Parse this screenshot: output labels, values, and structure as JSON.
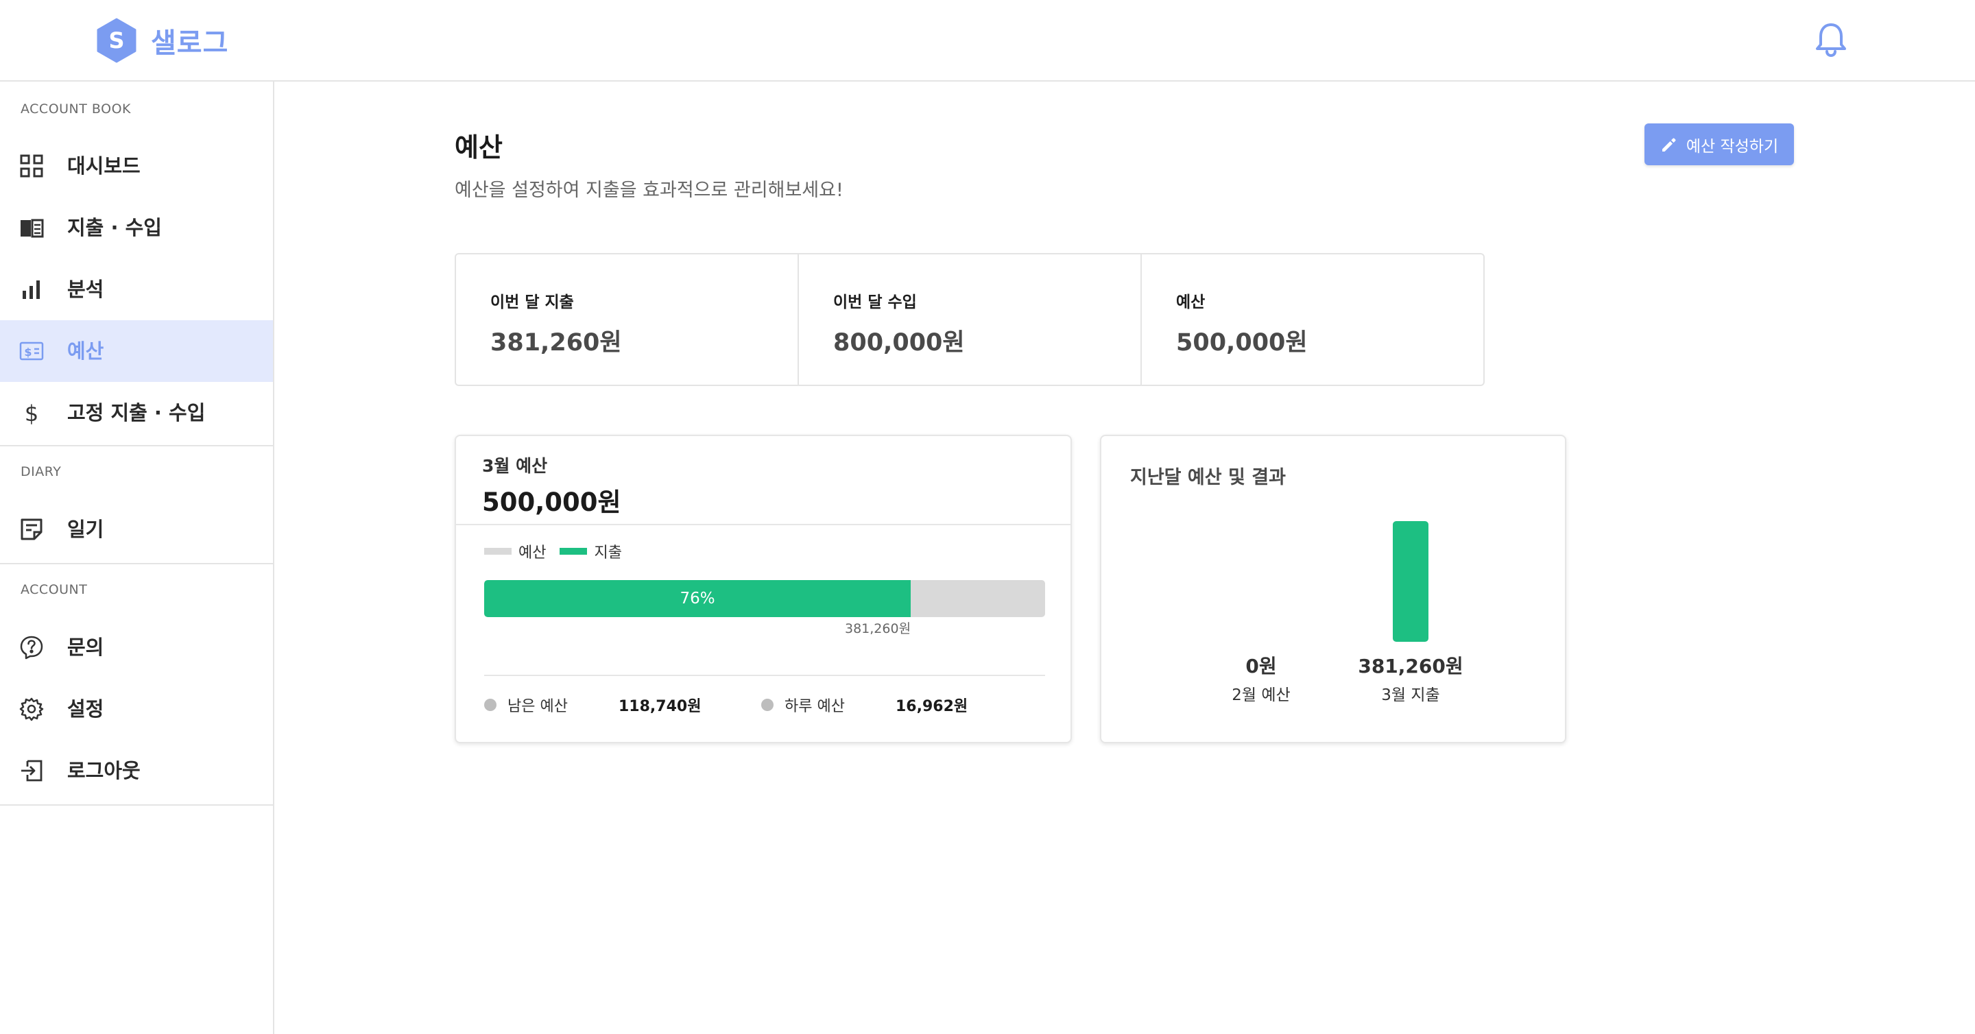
{
  "header": {
    "brand": "샐로그",
    "brand_color": "#7b9cf1",
    "logo_letter": "S",
    "icons": {
      "logo": "logo-hexagon-icon",
      "notification": "bell-icon"
    }
  },
  "sidebar": {
    "sections": [
      {
        "title": "ACCOUNT BOOK"
      },
      {
        "title": "DIARY"
      },
      {
        "title": "ACCOUNT"
      }
    ],
    "items": [
      {
        "label": "대시보드",
        "icon": "dashboard-grid-icon"
      },
      {
        "label": "지출 · 수입",
        "icon": "book-icon"
      },
      {
        "label": "분석",
        "icon": "bar-chart-icon"
      },
      {
        "label": "예산",
        "icon": "budget-card-icon",
        "active": true
      },
      {
        "label": "고정 지출 · 수입",
        "icon": "dollar-icon"
      },
      {
        "label": "일기",
        "icon": "note-icon"
      },
      {
        "label": "문의",
        "icon": "question-icon"
      },
      {
        "label": "설정",
        "icon": "gear-icon"
      },
      {
        "label": "로그아웃",
        "icon": "logout-icon"
      }
    ],
    "active_color": "#e3e9fd"
  },
  "main": {
    "title": "예산",
    "subtitle": "예산을 설정하여 지출을 효과적으로 관리해보세요!",
    "write_button": {
      "label": "예산 작성하기",
      "icon": "pencil-icon"
    },
    "stats": [
      {
        "label": "이번 달 지출",
        "value": "381,260원"
      },
      {
        "label": "이번 달 수입",
        "value": "800,000원"
      },
      {
        "label": "예산",
        "value": "500,000원"
      }
    ],
    "budget_card": {
      "month_label": "3월 예산",
      "amount": "500,000원",
      "legend": [
        {
          "label": "예산",
          "color": "#d9d9d9"
        },
        {
          "label": "지출",
          "color": "#1dbf82"
        }
      ],
      "progress_percent": 76,
      "progress_label": "76%",
      "spent_caption": "381,260원",
      "summary": [
        {
          "label": "남은 예산",
          "value": "118,740원"
        },
        {
          "label": "하루 예산",
          "value": "16,962원"
        }
      ]
    },
    "compare_card": {
      "title": "지난달 예산 및 결과",
      "bars": [
        {
          "value_label": "0원",
          "caption": "2월 예산",
          "value": 0
        },
        {
          "value_label": "381,260원",
          "caption": "3월 지출",
          "value": 381260
        }
      ],
      "bar_color": "#1dbf82"
    }
  }
}
